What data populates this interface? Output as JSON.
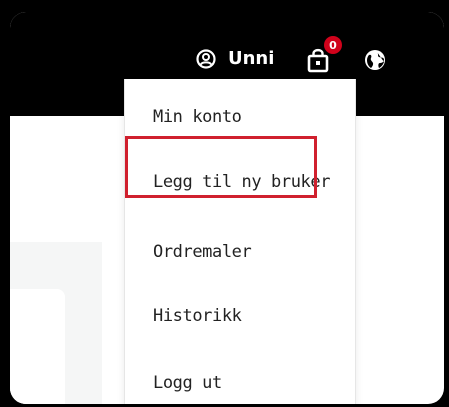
{
  "header": {
    "user_name": "Unni",
    "cart_count": "0"
  },
  "menu": {
    "items": [
      {
        "label": "Min konto"
      },
      {
        "label": "Legg til ny bruker"
      },
      {
        "label": "Ordremaler"
      },
      {
        "label": "Historikk"
      },
      {
        "label": "Logg ut"
      }
    ],
    "highlighted_item": "Legg til ny bruker"
  },
  "colors": {
    "topbar": "#000000",
    "badge": "#d0021b",
    "highlight_border": "#d0202e",
    "panel_bg": "#f5f6f6"
  },
  "icons": {
    "user": "user-circle-icon",
    "cart": "shopping-bag-icon",
    "globe": "globe-icon"
  }
}
